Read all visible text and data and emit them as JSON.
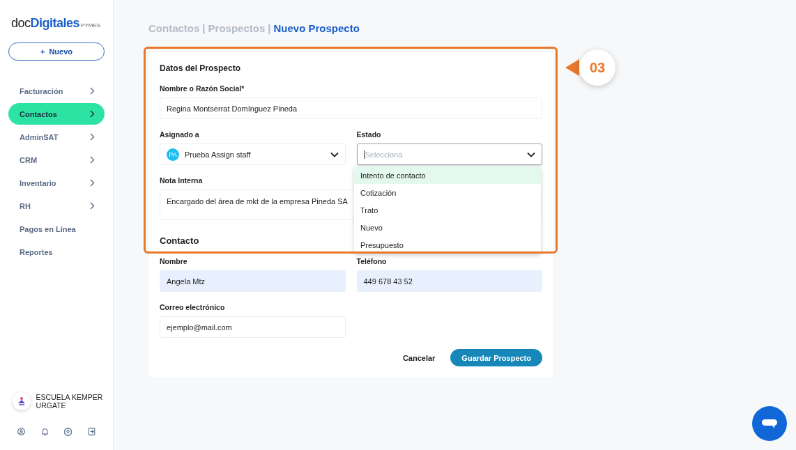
{
  "sidebar": {
    "logo": {
      "prefix": "doc",
      "brand": "Digitales",
      "suffix": "PYMES"
    },
    "new_button": {
      "icon": "+",
      "label": "Nuevo"
    },
    "items": [
      {
        "label": "Facturación",
        "has_submenu": true,
        "selected": false
      },
      {
        "label": "Contactos",
        "has_submenu": true,
        "selected": true
      },
      {
        "label": "AdminSAT",
        "has_submenu": true,
        "selected": false
      },
      {
        "label": "CRM",
        "has_submenu": true,
        "selected": false
      },
      {
        "label": "Inventario",
        "has_submenu": true,
        "selected": false
      },
      {
        "label": "RH",
        "has_submenu": true,
        "selected": false
      },
      {
        "label": "Pagos en Línea",
        "has_submenu": false,
        "selected": false
      },
      {
        "label": "Reportes",
        "has_submenu": false,
        "selected": false
      }
    ],
    "account": {
      "name": "ESCUELA KEMPER URGATE"
    }
  },
  "breadcrumb_separator": "|",
  "breadcrumb": [
    {
      "label": "Contactos",
      "selected": false
    },
    {
      "label": "Prospectos",
      "selected": false
    },
    {
      "label": "Nuevo Prospecto",
      "selected": true
    }
  ],
  "form": {
    "section_title": "Datos del Prospecto",
    "name_field": {
      "label": "Nombre o Razón Social*",
      "value": "Regina Montserrat Domínguez Pineda"
    },
    "assigned_field": {
      "label": "Asignado a",
      "avatar": "PA",
      "value": "Prueba Assign staff"
    },
    "status_field": {
      "label": "Estado",
      "placeholder": "Selecciona",
      "expanded": true,
      "options": [
        {
          "label": "Intento de contacto",
          "selected": true
        },
        {
          "label": "Cotización",
          "selected": false
        },
        {
          "label": "Trato",
          "selected": false
        },
        {
          "label": "Nuevo",
          "selected": false
        },
        {
          "label": "Presupuesto",
          "selected": false
        }
      ]
    },
    "note_field": {
      "label": "Nota Interna",
      "value": "Encargado del área de mkt de la empresa Pineda SA"
    },
    "contact_title": "Contacto",
    "contact_name_field": {
      "label": "Nombre",
      "value": "Angela Mtz"
    },
    "phone_field": {
      "label": "Teléfono",
      "value": "449 678 43 52"
    },
    "email_field": {
      "label": "Correo electrónico",
      "value": "ejemplo@mail.com"
    },
    "cancel_button": "Cancelar",
    "save_button": "Guardar Prospecto"
  },
  "step_badge": "03"
}
